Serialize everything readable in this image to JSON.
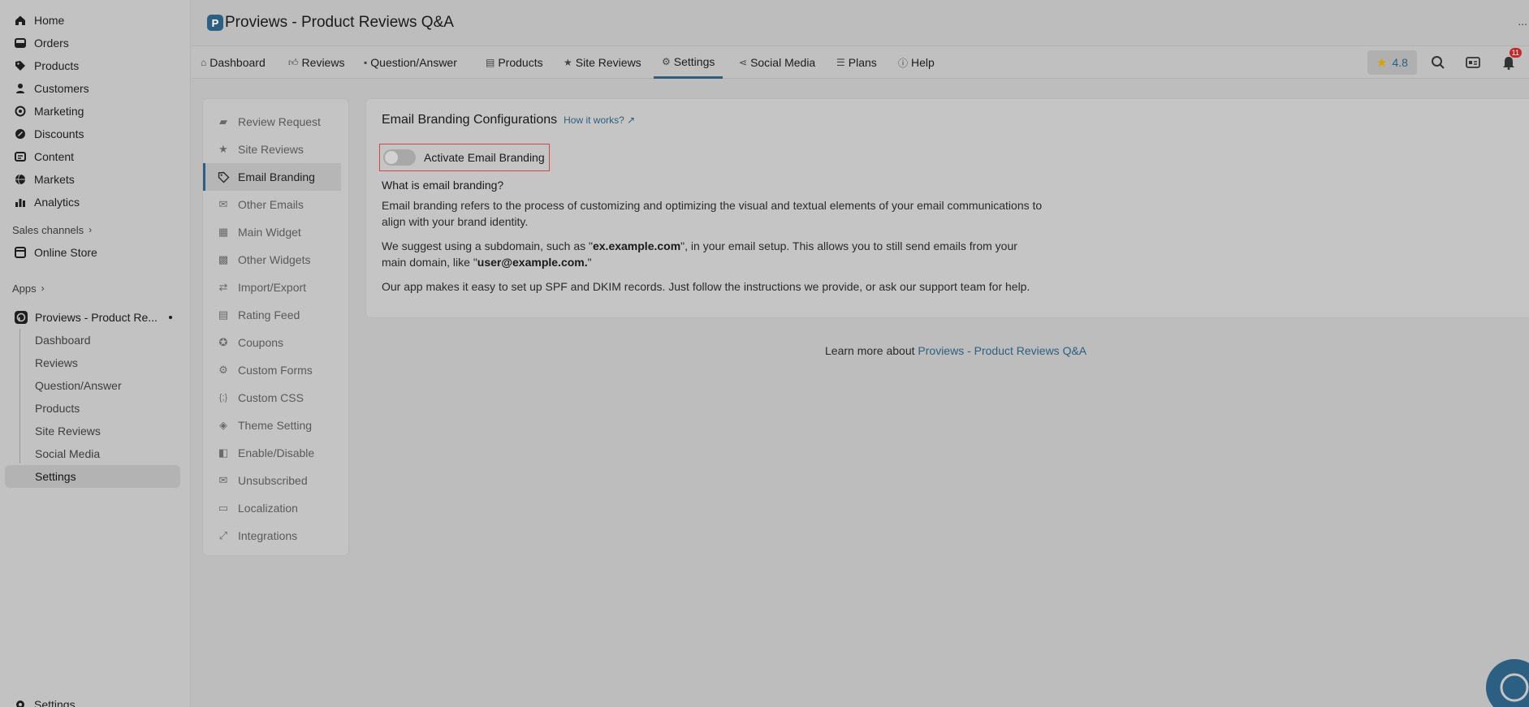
{
  "admin_nav": {
    "items": [
      {
        "label": "Home",
        "icon": "home-icon"
      },
      {
        "label": "Orders",
        "icon": "orders-icon"
      },
      {
        "label": "Products",
        "icon": "tag-icon"
      },
      {
        "label": "Customers",
        "icon": "person-icon"
      },
      {
        "label": "Marketing",
        "icon": "marketing-icon"
      },
      {
        "label": "Discounts",
        "icon": "discount-icon"
      },
      {
        "label": "Content",
        "icon": "content-icon"
      },
      {
        "label": "Markets",
        "icon": "globe-icon"
      },
      {
        "label": "Analytics",
        "icon": "analytics-icon"
      }
    ],
    "sales_channels_label": "Sales channels",
    "online_store_label": "Online Store",
    "apps_label": "Apps",
    "app_name": "Proviews - Product Re...",
    "app_subitems": [
      "Dashboard",
      "Reviews",
      "Question/Answer",
      "Products",
      "Site Reviews",
      "Social Media",
      "Settings"
    ],
    "active_subitem_index": 6,
    "bottom_settings_label": "Settings"
  },
  "header": {
    "title": "Proviews - Product Reviews Q&A",
    "logo_letter": "P",
    "more_label": "..."
  },
  "tabs": [
    {
      "label": "Dashboard",
      "icon": "home-icon"
    },
    {
      "label": "Reviews",
      "icon": "thumbs-up-icon"
    },
    {
      "label": "Question/Answer",
      "icon": "chat-icon"
    },
    {
      "label": "Products",
      "icon": "list-icon"
    },
    {
      "label": "Site Reviews",
      "icon": "star-icon"
    },
    {
      "label": "Settings",
      "icon": "gear-icon"
    },
    {
      "label": "Social Media",
      "icon": "share-icon"
    },
    {
      "label": "Plans",
      "icon": "plans-icon"
    },
    {
      "label": "Help",
      "icon": "info-icon"
    }
  ],
  "active_tab": "Settings",
  "toolbar": {
    "rating": "4.8",
    "notification_count": "11"
  },
  "settings_menu": [
    {
      "label": "Review Request",
      "icon": "review-request-icon"
    },
    {
      "label": "Site Reviews",
      "icon": "star-icon"
    },
    {
      "label": "Email Branding",
      "icon": "tag-outline-icon"
    },
    {
      "label": "Other Emails",
      "icon": "envelope-icon"
    },
    {
      "label": "Main Widget",
      "icon": "widget-icon"
    },
    {
      "label": "Other Widgets",
      "icon": "widgets-icon"
    },
    {
      "label": "Import/Export",
      "icon": "import-export-icon"
    },
    {
      "label": "Rating Feed",
      "icon": "feed-icon"
    },
    {
      "label": "Coupons",
      "icon": "coupon-icon"
    },
    {
      "label": "Custom Forms",
      "icon": "custom-forms-icon"
    },
    {
      "label": "Custom CSS",
      "icon": "css-icon"
    },
    {
      "label": "Theme Setting",
      "icon": "theme-icon"
    },
    {
      "label": "Enable/Disable",
      "icon": "toggle-icon"
    },
    {
      "label": "Unsubscribed",
      "icon": "unsubscribed-icon"
    },
    {
      "label": "Localization",
      "icon": "localization-icon"
    },
    {
      "label": "Integrations",
      "icon": "integrations-icon"
    }
  ],
  "active_menu_item": "Email Branding",
  "main": {
    "title": "Email Branding Configurations",
    "how_it_works": "How it works?",
    "toggle_label": "Activate Email Branding",
    "toggle_on": false,
    "question": "What is email branding?",
    "para1": "Email branding refers to the process of customizing and optimizing the visual and textual elements of your email communications to align with your brand identity.",
    "para2_a": "We suggest using a subdomain, such as \"",
    "para2_b": "ex.example.com",
    "para2_c": "\", in your email setup. This allows you to still send emails from your main domain, like \"",
    "para2_d": "user@example.com.",
    "para2_e": "\"",
    "para3": "Our app makes it easy to set up SPF and DKIM records. Just follow the instructions we provide, or ask our support team for help."
  },
  "footer": {
    "learn_more": "Learn more about ",
    "learn_more_link": "Proviews - Product Reviews Q&A"
  },
  "colors": {
    "accent": "#2c5f82",
    "highlight_border": "#d64545",
    "star": "#d8a200",
    "badge": "#c62828"
  }
}
